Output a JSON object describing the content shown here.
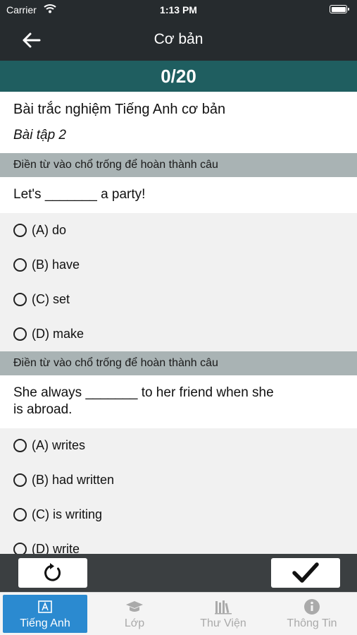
{
  "status_bar": {
    "carrier": "Carrier",
    "time": "1:13 PM"
  },
  "nav": {
    "title": "Cơ bản"
  },
  "score": {
    "text": "0/20"
  },
  "quiz": {
    "title": "Bài trắc nghiệm Tiếng Anh cơ bản",
    "subtitle": "Bài tập 2"
  },
  "questions": [
    {
      "instruction": "Điền từ vào chổ trống để hoàn thành câu",
      "text": "Let's _______ a party!",
      "options": [
        "(A) do",
        "(B) have",
        "(C) set",
        "(D) make"
      ]
    },
    {
      "instruction": "Điền từ vào chổ trống để hoàn thành câu",
      "text_line1": "She always _______ to her  friend when she",
      "text_line2": "is abroad.",
      "options": [
        "(A) writes",
        "(B) had written",
        "(C) is writing",
        "(D) write"
      ]
    }
  ],
  "tabs": [
    {
      "label": "Tiếng Anh",
      "icon": "book-a-icon",
      "active": true
    },
    {
      "label": "Lớp",
      "icon": "graduation-cap-icon",
      "active": false
    },
    {
      "label": "Thư Viện",
      "icon": "library-icon",
      "active": false
    },
    {
      "label": "Thông Tin",
      "icon": "info-icon",
      "active": false
    }
  ],
  "colors": {
    "header_bg": "#262b2e",
    "score_bg": "#1f5e60",
    "instruction_bg": "#a9b3b4",
    "action_bar_bg": "#3b3f41",
    "tab_active": "#2b8ad0"
  }
}
